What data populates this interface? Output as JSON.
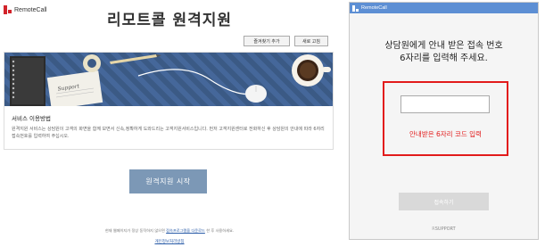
{
  "brand": {
    "logo_text": "RemoteCall",
    "accent_color": "#d2232a"
  },
  "page": {
    "title": "리모트콜 원격지원",
    "favorites_button": "즐겨찾기 추가",
    "refresh_button": "새로 고침",
    "section_heading": "서비스 이용방법",
    "section_desc": "원격지원 서비스는 상담원이 고객의 화면을 함께 보면서 신속,정확하게 도와드리는 고객지원서비스입니다. 먼저 고객지원센터로 전화하신 후 상담원의 안내에 따라 6자리 접속번호를 입력하여 주십시오.",
    "banner_paper_text": "Support",
    "start_button": "원격지원 시작",
    "footer_prefix": "현재 웹페이지가 정상 동작하지 않으면",
    "footer_link": "접속프로그램을 다운로드",
    "footer_suffix": "한 후 사용하세요.",
    "privacy_link": "개인정보처리방침"
  },
  "popup": {
    "title": "RemoteCall",
    "title_bar_color": "#5d8fd4",
    "instruction_line1": "상담원에게 안내 받은 접속 번호",
    "instruction_line2": "6자리를 입력해 주세요.",
    "code_input_value": "",
    "code_input_placeholder": "",
    "highlight_color": "#e21b1b",
    "highlight_label": "안내받은 6자리 코드 입력",
    "connect_button": "접속하기",
    "vendor_prefix": "R",
    "vendor_name": "SUPPORT"
  }
}
